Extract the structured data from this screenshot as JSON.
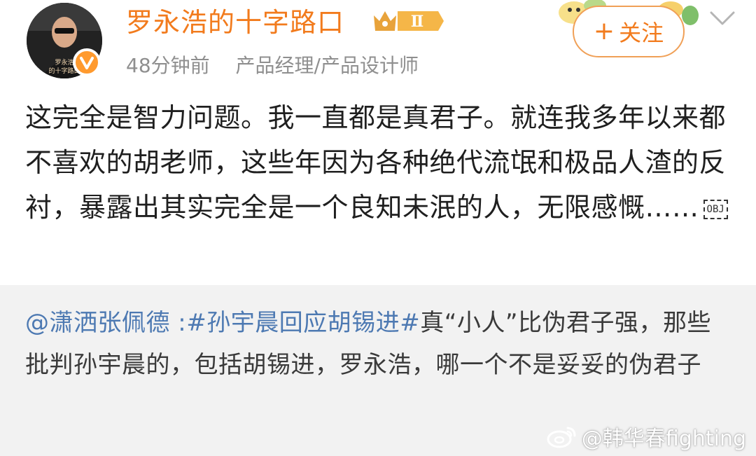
{
  "header": {
    "username": "罗永浩的十字路口",
    "vip_level": "Ⅱ",
    "time": "48分钟前",
    "source": "产品经理/产品设计师",
    "follow_label": "关注",
    "avatar_caption_line1": "罗永浩",
    "avatar_caption_line2": "的十字路口"
  },
  "post": {
    "text": "这完全是智力问题。我一直都是真君子。就连我多年以来都不喜欢的胡老师，这些年因为各种绝代流氓和极品人渣的反衬，暴露出其实完全是一个良知未泯的人，无限感慨……",
    "obj_label": "OBJ"
  },
  "repost": {
    "mention": "@潇洒张佩德",
    "separator": " :",
    "hashtag": "#孙宇晨回应胡锡进#",
    "text": "真“小人”比伪君子强，那些批判孙宇晨的，包括胡锡进，罗永浩，哪一个不是妥妥的伪君子"
  },
  "watermark": {
    "text": "@韩华春fighting"
  },
  "colors": {
    "username": "#f27b1d",
    "link": "#4d79b2",
    "repost_bg": "#f2f2f2",
    "meta": "#8f8f8f"
  }
}
